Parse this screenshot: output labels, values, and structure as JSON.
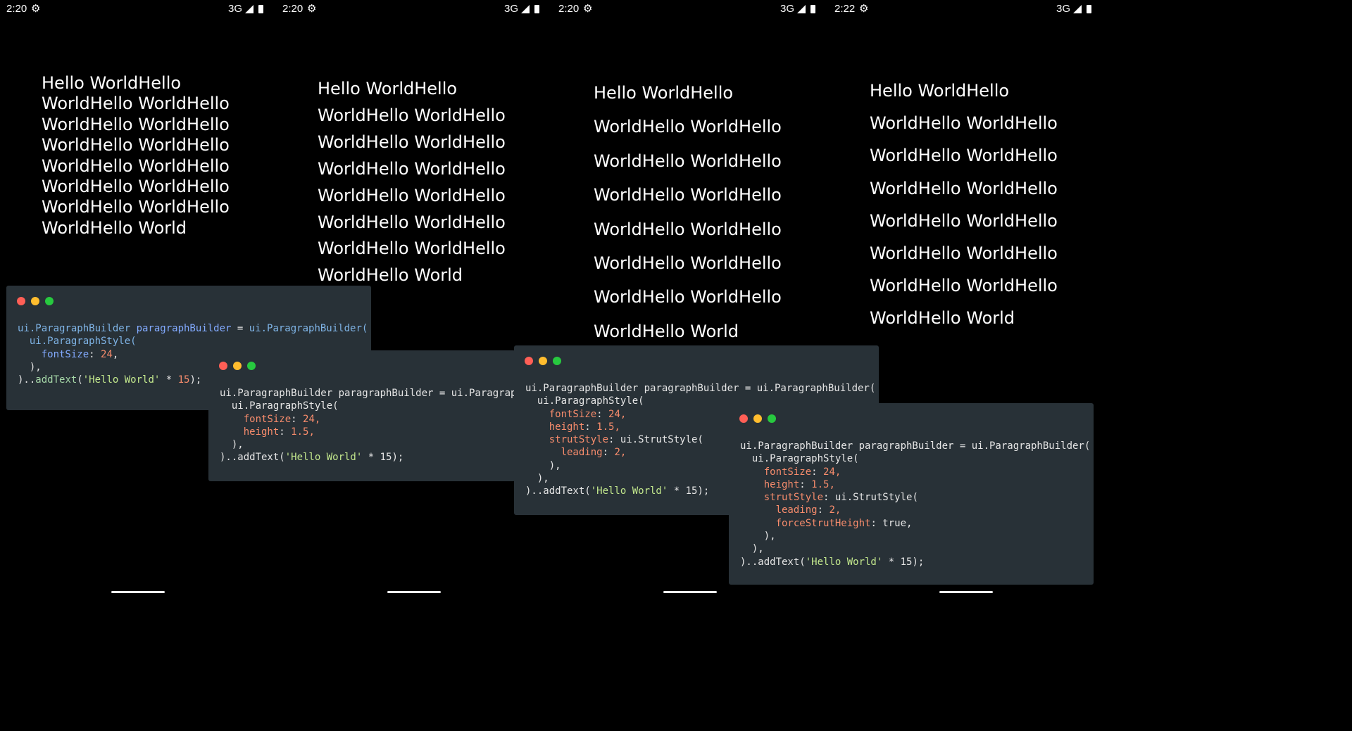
{
  "screens": [
    {
      "time": "2:20",
      "network": "3G",
      "lines": [
        "Hello WorldHello",
        "WorldHello WorldHello",
        "WorldHello WorldHello",
        "WorldHello WorldHello",
        "WorldHello WorldHello",
        "WorldHello WorldHello",
        "WorldHello WorldHello",
        "WorldHello World"
      ]
    },
    {
      "time": "2:20",
      "network": "3G",
      "lines": [
        "Hello WorldHello",
        "WorldHello WorldHello",
        "WorldHello WorldHello",
        "WorldHello WorldHello",
        "WorldHello WorldHello",
        "WorldHello WorldHello",
        "WorldHello WorldHello",
        "WorldHello World"
      ]
    },
    {
      "time": "2:20",
      "network": "3G",
      "lines": [
        "Hello WorldHello",
        "WorldHello WorldHello",
        "WorldHello WorldHello",
        "WorldHello WorldHello",
        "WorldHello WorldHello",
        "WorldHello WorldHello",
        "WorldHello WorldHello",
        "WorldHello World"
      ]
    },
    {
      "time": "2:22",
      "network": "3G",
      "lines": [
        "Hello WorldHello",
        "WorldHello WorldHello",
        "WorldHello WorldHello",
        "WorldHello WorldHello",
        "WorldHello WorldHello",
        "WorldHello WorldHello",
        "WorldHello WorldHello",
        "WorldHello World"
      ]
    }
  ],
  "snippets": [
    {
      "lines": [
        [
          [
            "cls",
            "ui.ParagraphBuilder "
          ],
          [
            "prop",
            "paragraphBuilder"
          ],
          [
            "pl",
            " = "
          ],
          [
            "cls",
            "ui.ParagraphBuilder("
          ]
        ],
        [
          [
            "pl",
            "  "
          ],
          [
            "cls",
            "ui.ParagraphStyle("
          ]
        ],
        [
          [
            "pl",
            "    "
          ],
          [
            "prop",
            "fontSize"
          ],
          [
            "pl",
            ": "
          ],
          [
            "num",
            "24"
          ],
          [
            "pl",
            ","
          ]
        ],
        [
          [
            "pl",
            "  ),"
          ]
        ],
        [
          [
            "pl",
            ").."
          ],
          [
            "fn",
            "addText"
          ],
          [
            "pl",
            "("
          ],
          [
            "str",
            "'Hello World'"
          ],
          [
            "pl",
            " * "
          ],
          [
            "num",
            "15"
          ],
          [
            "pl",
            ");"
          ]
        ]
      ]
    },
    {
      "lines": [
        [
          [
            "pl",
            "ui.ParagraphBuilder paragraphBuilder = ui.ParagraphBuilder("
          ]
        ],
        [
          [
            "pl",
            "  ui.ParagraphStyle("
          ]
        ],
        [
          [
            "pl",
            "    "
          ],
          [
            "key",
            "fontSize"
          ],
          [
            "pl",
            ": "
          ],
          [
            "num",
            "24,"
          ]
        ],
        [
          [
            "pl",
            "    "
          ],
          [
            "key",
            "height"
          ],
          [
            "pl",
            ": "
          ],
          [
            "num",
            "1.5,"
          ]
        ],
        [
          [
            "pl",
            "  ),"
          ]
        ],
        [
          [
            "pl",
            ")..addText("
          ],
          [
            "str",
            "'Hello World'"
          ],
          [
            "pl",
            " * 15);"
          ]
        ]
      ]
    },
    {
      "lines": [
        [
          [
            "pl",
            "ui.ParagraphBuilder paragraphBuilder = ui.ParagraphBuilder("
          ]
        ],
        [
          [
            "pl",
            "  ui.ParagraphStyle("
          ]
        ],
        [
          [
            "pl",
            "    "
          ],
          [
            "key",
            "fontSize"
          ],
          [
            "pl",
            ": "
          ],
          [
            "num",
            "24,"
          ]
        ],
        [
          [
            "pl",
            "    "
          ],
          [
            "key",
            "height"
          ],
          [
            "pl",
            ": "
          ],
          [
            "num",
            "1.5,"
          ]
        ],
        [
          [
            "pl",
            "    "
          ],
          [
            "key",
            "strutStyle"
          ],
          [
            "pl",
            ": ui.StrutStyle("
          ]
        ],
        [
          [
            "pl",
            "      "
          ],
          [
            "key",
            "leading"
          ],
          [
            "pl",
            ": "
          ],
          [
            "num",
            "2,"
          ]
        ],
        [
          [
            "pl",
            "    ),"
          ]
        ],
        [
          [
            "pl",
            "  ),"
          ]
        ],
        [
          [
            "pl",
            ")..addText("
          ],
          [
            "str",
            "'Hello World'"
          ],
          [
            "pl",
            " * 15);"
          ]
        ]
      ]
    },
    {
      "lines": [
        [
          [
            "pl",
            "ui.ParagraphBuilder paragraphBuilder = ui.ParagraphBuilder("
          ]
        ],
        [
          [
            "pl",
            "  ui.ParagraphStyle("
          ]
        ],
        [
          [
            "pl",
            "    "
          ],
          [
            "key",
            "fontSize"
          ],
          [
            "pl",
            ": "
          ],
          [
            "num",
            "24,"
          ]
        ],
        [
          [
            "pl",
            "    "
          ],
          [
            "key",
            "height"
          ],
          [
            "pl",
            ": "
          ],
          [
            "num",
            "1.5,"
          ]
        ],
        [
          [
            "pl",
            "    "
          ],
          [
            "key",
            "strutStyle"
          ],
          [
            "pl",
            ": ui.StrutStyle("
          ]
        ],
        [
          [
            "pl",
            "      "
          ],
          [
            "key",
            "leading"
          ],
          [
            "pl",
            ": "
          ],
          [
            "num",
            "2,"
          ]
        ],
        [
          [
            "pl",
            "      "
          ],
          [
            "key",
            "forceStrutHeight"
          ],
          [
            "pl",
            ": true,"
          ]
        ],
        [
          [
            "pl",
            "    ),"
          ]
        ],
        [
          [
            "pl",
            "  ),"
          ]
        ],
        [
          [
            "pl",
            ")..addText("
          ],
          [
            "str",
            "'Hello World'"
          ],
          [
            "pl",
            " * 15);"
          ]
        ]
      ]
    }
  ],
  "colors": {
    "panel": "#283137",
    "dot_red": "#ff5f56",
    "dot_yellow": "#ffbd2e",
    "dot_green": "#27c93f"
  }
}
